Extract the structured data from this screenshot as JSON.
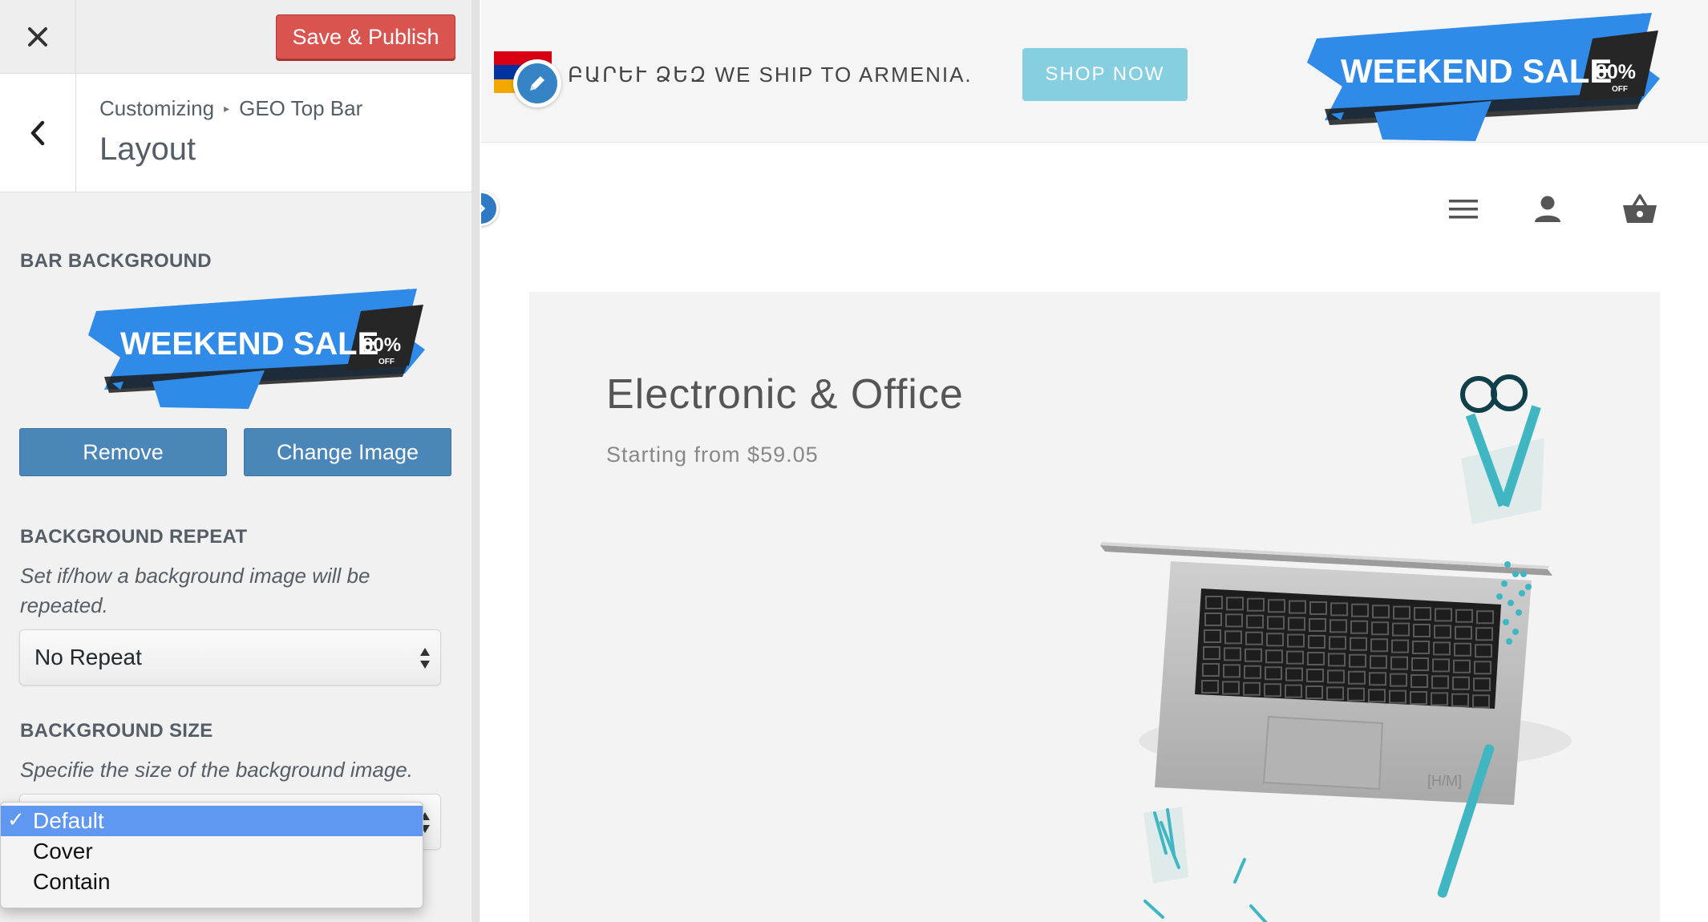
{
  "sidebar": {
    "close_label": "Close customizer",
    "save_label": "Save & Publish",
    "breadcrumb": {
      "root": "Customizing",
      "section": "GEO Top Bar"
    },
    "section_title": "Layout",
    "bar_background": {
      "title": "BAR BACKGROUND",
      "preview_image": {
        "main": "WEEKEND SALE",
        "percent": "80%",
        "off": "OFF"
      },
      "remove_label": "Remove",
      "change_label": "Change Image"
    },
    "background_repeat": {
      "title": "BACKGROUND REPEAT",
      "description": "Set if/how a background image will be repeated.",
      "selected": "No Repeat"
    },
    "background_size": {
      "title": "BACKGROUND SIZE",
      "description": "Specifie the size of the background image.",
      "options": [
        "Default",
        "Cover",
        "Contain"
      ],
      "selected_index": 0,
      "check_mark": "✓"
    }
  },
  "preview": {
    "top_bar": {
      "flag_colors": [
        "#d90012",
        "#0033a0",
        "#f2a800"
      ],
      "message": "ԲԱՐԵՒ  ՁԵԶ WE SHIP TO ARMENIA.",
      "button_label": "SHOP NOW",
      "banner": {
        "main": "WEEKEND SALE",
        "percent": "80%",
        "off": "OFF"
      }
    },
    "header_icons": [
      "menu-icon",
      "user-icon",
      "cart-icon"
    ],
    "hero": {
      "title": "Electronic & Office",
      "subtitle": "Starting from $59.05",
      "laptop_mark": "[H/M]"
    }
  },
  "colors": {
    "publish": "#d9534f",
    "primary_button": "#4a86b8",
    "shop_now": "#86cfe0",
    "banner_blue": "#2f8ae8",
    "accent_teal": "#3fb6c2",
    "dropdown_highlight": "#5e98f0"
  }
}
